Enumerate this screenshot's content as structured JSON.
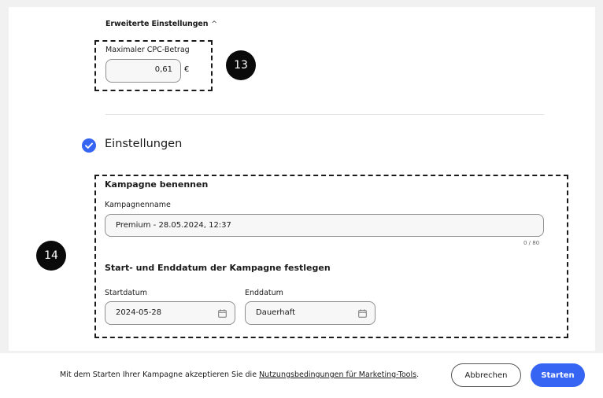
{
  "advanced": {
    "title": "Erweiterte Einstellungen",
    "chevron": "^"
  },
  "cpc": {
    "label": "Maximaler CPC-Betrag",
    "value": "0,61",
    "unit": "€"
  },
  "markers": {
    "m13": "13",
    "m14": "14"
  },
  "settings": {
    "title": "Einstellungen",
    "icon": "check-circle-icon",
    "accent": "#3665f3"
  },
  "campaign": {
    "heading": "Kampagne benennen",
    "name_label": "Kampagnenname",
    "name_value": "Premium - 28.05.2024, 12:37",
    "counter": "0 / 80"
  },
  "dates": {
    "heading": "Start- und Enddatum der Kampagne festlegen",
    "start_label": "Startdatum",
    "start_value": "2024-05-28",
    "end_label": "Enddatum",
    "end_value": "Dauerhaft"
  },
  "footer": {
    "terms_prefix": "Mit dem Starten Ihrer Kampagne akzeptieren Sie die ",
    "terms_link": "Nutzungsbedingungen für Marketing-Tools",
    "terms_suffix": ".",
    "cancel": "Abbrechen",
    "start": "Starten"
  }
}
